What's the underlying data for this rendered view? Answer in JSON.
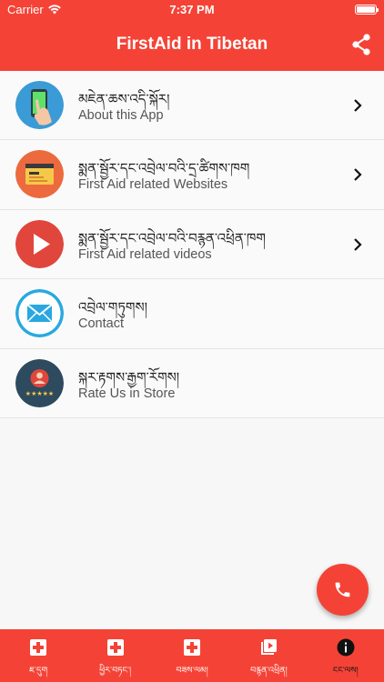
{
  "status_bar": {
    "carrier": "Carrier",
    "time": "7:37 PM"
  },
  "nav": {
    "title": "FirstAid in Tibetan"
  },
  "list": {
    "items": [
      {
        "tibetan": "མཇེན་ཆས་འདི་སྐོར།",
        "english": "About this App",
        "icon": "phone-hand-icon"
      },
      {
        "tibetan": "སྨན་སྦྱོར་དང་འབྲེལ་བའི་དྲ་ཚིགས་ཁག",
        "english": "First Aid related Websites",
        "icon": "website-icon"
      },
      {
        "tibetan": "སྨན་སྦྱོར་དང་འབྲེལ་བའི་བརྙན་འཕྲིན་ཁག",
        "english": "First Aid related videos",
        "icon": "video-play-icon"
      },
      {
        "tibetan": "འབྲེལ་གཏུགས།",
        "english": "Contact",
        "icon": "mail-icon"
      },
      {
        "tibetan": "སྐར་རྟགས་རྒྱག་རོགས།",
        "english": "Rate Us in Store",
        "icon": "rate-icon"
      }
    ]
  },
  "tabs": [
    {
      "label": "ཇ་དུག",
      "icon": "first-aid-icon",
      "active": false
    },
    {
      "label": "ཕྱིར་བཏང་།",
      "icon": "first-aid-icon",
      "active": false
    },
    {
      "label": "བཟས་ལམ།",
      "icon": "first-aid-icon",
      "active": false
    },
    {
      "label": "བརྙན་འཕྲིན།",
      "icon": "video-library-icon",
      "active": false
    },
    {
      "label": "ངང་ལས།",
      "icon": "info-icon",
      "active": true
    }
  ],
  "colors": {
    "primary": "#f44336",
    "active_tab_text": "#111111"
  }
}
